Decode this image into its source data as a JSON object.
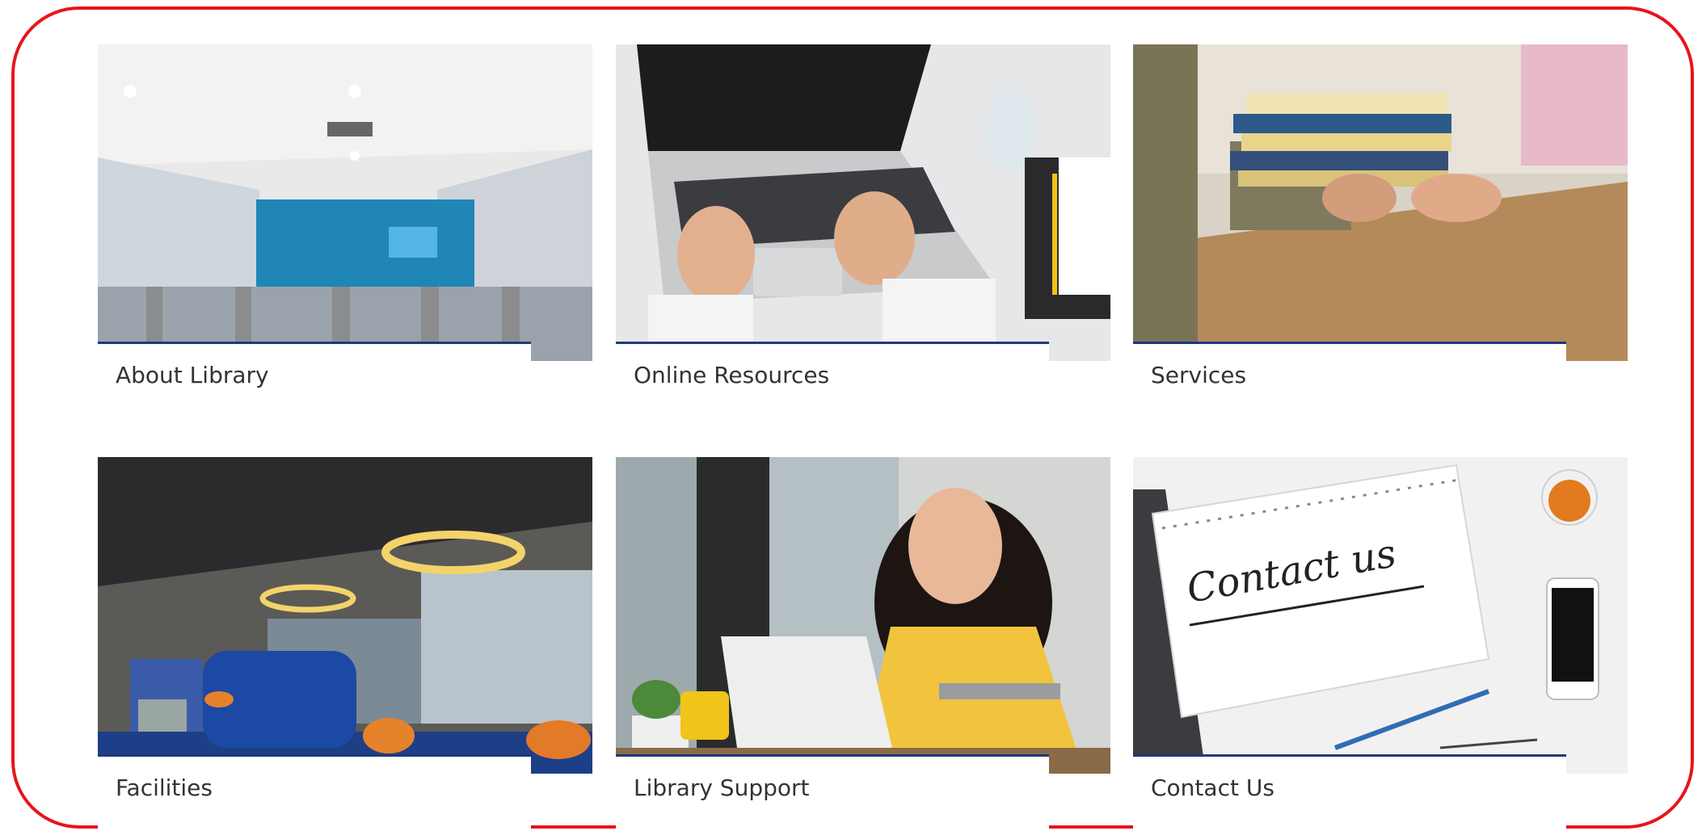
{
  "cards": [
    {
      "label": "About Library",
      "image_subject": "library-entrance-photo"
    },
    {
      "label": "Online Resources",
      "image_subject": "laptop-typing-photo"
    },
    {
      "label": "Services",
      "image_subject": "books-handover-photo"
    },
    {
      "label": "Facilities",
      "image_subject": "library-lounge-photo"
    },
    {
      "label": "Library Support",
      "image_subject": "student-laptop-photo"
    },
    {
      "label": "Contact Us",
      "image_subject": "contact-notebook-photo"
    }
  ],
  "contact_note_text": "Contact us",
  "colors": {
    "frame": "#e8141b",
    "caption_rule": "#1e3a78",
    "caption_text": "#333333"
  }
}
